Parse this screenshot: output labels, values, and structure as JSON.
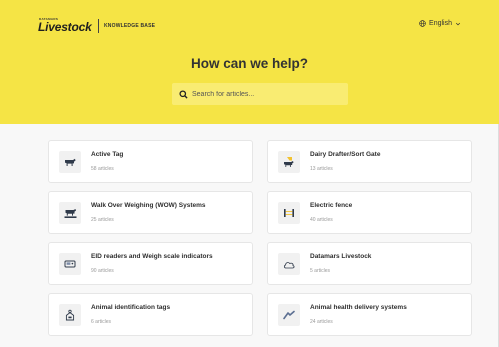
{
  "header": {
    "brand_top": "DATAMARS",
    "brand_name": "Livestock",
    "section": "KNOWLEDGE BASE",
    "language": "English",
    "language_icon": "globe-icon"
  },
  "hero": {
    "title": "How can we help?",
    "search_placeholder": "Search for articles..."
  },
  "categories": [
    {
      "title": "Active Tag",
      "count": "58 articles",
      "icon": "cow-icon"
    },
    {
      "title": "Dairy Drafter/Sort Gate",
      "count": "13 articles",
      "icon": "cow-gate-icon"
    },
    {
      "title": "Walk Over Weighing (WOW) Systems",
      "count": "25 articles",
      "icon": "cattle-weighing-icon"
    },
    {
      "title": "Electric fence",
      "count": "40 articles",
      "icon": "fence-icon"
    },
    {
      "title": "EID readers and Weigh scale indicators",
      "count": "90 articles",
      "icon": "reader-device-icon"
    },
    {
      "title": "Datamars Livestock",
      "count": "5 articles",
      "icon": "cloud-icon"
    },
    {
      "title": "Animal identification tags",
      "count": "6 articles",
      "icon": "ear-tag-icon"
    },
    {
      "title": "Animal health delivery systems",
      "count": "24 articles",
      "icon": "applicator-icon"
    }
  ],
  "colors": {
    "hero_bg": "#f5e445",
    "search_bg": "#f9ec72",
    "accent_yellow": "#f2c230",
    "icon_dark": "#2f3a4a"
  }
}
